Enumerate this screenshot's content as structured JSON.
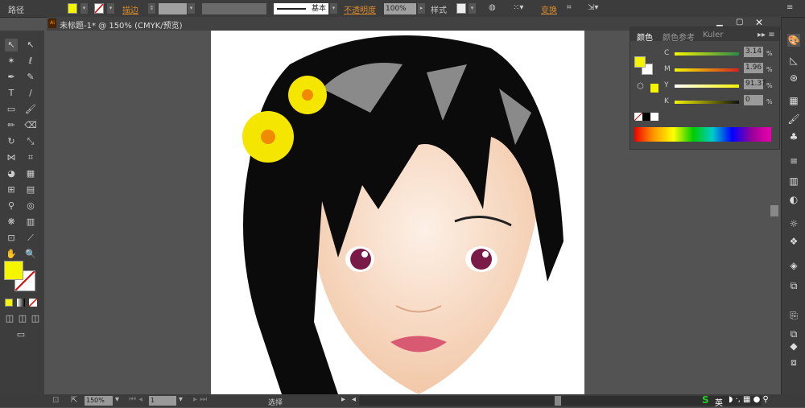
{
  "control_bar": {
    "selection_type": "路径",
    "fill_color": "#f5f500",
    "stroke_label": "描边",
    "stroke_profile": "基本",
    "opacity_label": "不透明度",
    "opacity_value": "100%",
    "style_label": "样式",
    "transform_label": "变换"
  },
  "document": {
    "tab_title": "未标题-1* @ 150% (CMYK/预览)",
    "app_icon": "Ai"
  },
  "color_panel": {
    "tabs": [
      "颜色",
      "颜色参考",
      "Kuler"
    ],
    "active_tab": "颜色",
    "channels": [
      {
        "label": "C",
        "value": "3.14",
        "color": "#2b8a4a"
      },
      {
        "label": "M",
        "value": "1.96",
        "color": "#d42222"
      },
      {
        "label": "Y",
        "value": "91.37",
        "color": "#f3f000"
      },
      {
        "label": "K",
        "value": "0",
        "color": "#111111"
      }
    ],
    "percent": "%",
    "fill": "#f5f500"
  },
  "status_bar": {
    "zoom": "150%",
    "page": "1",
    "tool_status": "选择"
  },
  "ime": {
    "label": "英"
  }
}
